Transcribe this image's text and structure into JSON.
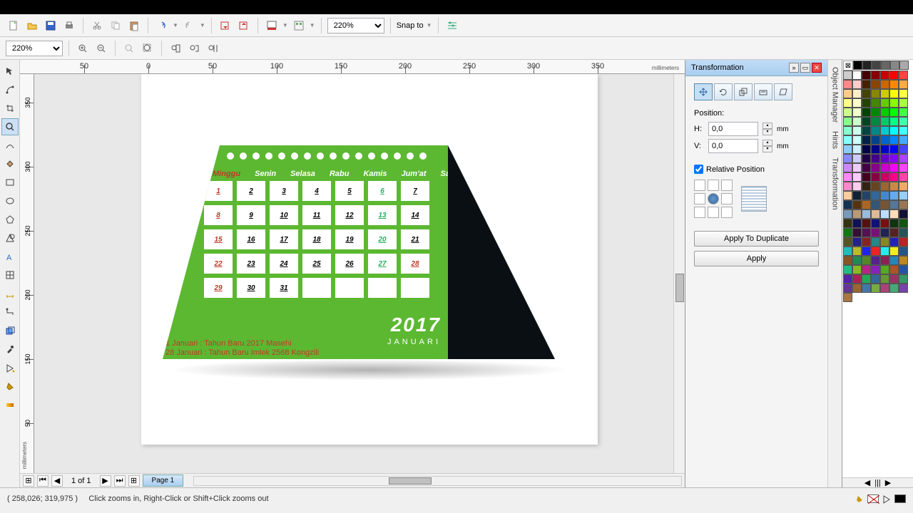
{
  "toolbar": {
    "zoom_main": "220%",
    "zoom_top": "220%",
    "snap_label": "Snap to"
  },
  "rulers": {
    "h_ticks": [
      {
        "v": "50",
        "p": 90
      },
      {
        "v": "0",
        "p": 180
      },
      {
        "v": "50",
        "p": 270
      },
      {
        "v": "100",
        "p": 360
      },
      {
        "v": "150",
        "p": 450
      },
      {
        "v": "200",
        "p": 540
      },
      {
        "v": "250",
        "p": 630
      },
      {
        "v": "300",
        "p": 720
      },
      {
        "v": "350",
        "p": 810
      }
    ],
    "v_ticks": [
      {
        "v": "350",
        "p": 40
      },
      {
        "v": "300",
        "p": 130
      },
      {
        "v": "250",
        "p": 220
      },
      {
        "v": "200",
        "p": 310
      },
      {
        "v": "150",
        "p": 400
      },
      {
        "v": "50",
        "p": 490
      }
    ],
    "unit": "millimeters"
  },
  "pagebar": {
    "counter": "1 of 1",
    "tab": "Page 1"
  },
  "panel": {
    "title": "Transformation",
    "section": "Position:",
    "h_label": "H:",
    "h_val": "0,0",
    "v_label": "V:",
    "v_val": "0,0",
    "unit": "mm",
    "relative": "Relative Position",
    "apply_dup": "Apply To Duplicate",
    "apply": "Apply"
  },
  "side_tabs": [
    "Object Manager",
    "Hints",
    "Transformation"
  ],
  "calendar": {
    "days": [
      "Minggu",
      "Senin",
      "Selasa",
      "Rabu",
      "Kamis",
      "Jum'at",
      "Sabtu"
    ],
    "cells": [
      {
        "n": "1",
        "c": "red"
      },
      {
        "n": "2"
      },
      {
        "n": "3"
      },
      {
        "n": "4"
      },
      {
        "n": "5"
      },
      {
        "n": "6",
        "c": "green"
      },
      {
        "n": "7"
      },
      {
        "n": "8",
        "c": "red"
      },
      {
        "n": "9"
      },
      {
        "n": "10"
      },
      {
        "n": "11"
      },
      {
        "n": "12"
      },
      {
        "n": "13",
        "c": "green"
      },
      {
        "n": "14"
      },
      {
        "n": "15",
        "c": "red"
      },
      {
        "n": "16"
      },
      {
        "n": "17"
      },
      {
        "n": "18"
      },
      {
        "n": "19"
      },
      {
        "n": "20",
        "c": "green"
      },
      {
        "n": "21"
      },
      {
        "n": "22",
        "c": "red"
      },
      {
        "n": "23"
      },
      {
        "n": "24"
      },
      {
        "n": "25"
      },
      {
        "n": "26"
      },
      {
        "n": "27",
        "c": "green"
      },
      {
        "n": "28",
        "c": "red"
      },
      {
        "n": "29",
        "c": "red"
      },
      {
        "n": "30"
      },
      {
        "n": "31"
      },
      {
        "n": ""
      },
      {
        "n": ""
      },
      {
        "n": ""
      },
      {
        "n": ""
      }
    ],
    "year": "2017",
    "month": "JANUARI",
    "footer1": "1 Januari  :  Tahun Baru 2017 Masehi",
    "footer2": "28 Januari :  Tahun Baru Imlek 2568 Kongzili"
  },
  "palette_colors": [
    "#000",
    "#222",
    "#444",
    "#666",
    "#888",
    "#aaa",
    "#ccc",
    "#fff",
    "#400",
    "#800",
    "#c00",
    "#f00",
    "#f44",
    "#f88",
    "#fcc",
    "#420",
    "#840",
    "#c60",
    "#f80",
    "#fa4",
    "#fc8",
    "#fec",
    "#440",
    "#880",
    "#cc0",
    "#ff0",
    "#ff4",
    "#ff8",
    "#ffc",
    "#240",
    "#480",
    "#6c0",
    "#8f0",
    "#af4",
    "#cf8",
    "#efc",
    "#040",
    "#080",
    "#0c0",
    "#0f0",
    "#4f4",
    "#8f8",
    "#cfc",
    "#042",
    "#084",
    "#0c6",
    "#0f8",
    "#4fa",
    "#8fc",
    "#cfe",
    "#044",
    "#088",
    "#0cc",
    "#0ff",
    "#4ff",
    "#8ff",
    "#cff",
    "#024",
    "#048",
    "#06c",
    "#08f",
    "#4af",
    "#8cf",
    "#cef",
    "#004",
    "#008",
    "#00c",
    "#00f",
    "#44f",
    "#88f",
    "#ccf",
    "#204",
    "#408",
    "#60c",
    "#80f",
    "#a4f",
    "#c8f",
    "#ecf",
    "#404",
    "#808",
    "#c0c",
    "#f0f",
    "#f4f",
    "#f8f",
    "#fcf",
    "#402",
    "#804",
    "#c06",
    "#f08",
    "#f4a",
    "#f8c",
    "#fce",
    "#321",
    "#642",
    "#963",
    "#c84",
    "#ea6",
    "#fc9",
    "#123",
    "#246",
    "#369",
    "#48c",
    "#6ae",
    "#9cf",
    "#135",
    "#531",
    "#a62",
    "#357",
    "#753",
    "#579",
    "#975",
    "#79b",
    "#b97",
    "#9bd",
    "#db9",
    "#bdf",
    "#fdb",
    "#113",
    "#331",
    "#115",
    "#511",
    "#117",
    "#711",
    "#131",
    "#151",
    "#171",
    "#313",
    "#515",
    "#717",
    "#225",
    "#522",
    "#255",
    "#552",
    "#228",
    "#822",
    "#288",
    "#882",
    "#22b",
    "#b22",
    "#2bb",
    "#bb2",
    "#22e",
    "#e22",
    "#2ee",
    "#ee2",
    "#258",
    "#852",
    "#285",
    "#582",
    "#528",
    "#825",
    "#28b",
    "#b82",
    "#2b8",
    "#8b2",
    "#b28",
    "#82b",
    "#5a2",
    "#a52",
    "#25a",
    "#52a",
    "#a25",
    "#2a5",
    "#369",
    "#693",
    "#936",
    "#396",
    "#639",
    "#963",
    "#47a",
    "#7a4",
    "#a47",
    "#4a7",
    "#74a",
    "#a74"
  ],
  "status": {
    "coords": "( 258,026; 319,975 )",
    "hint": "Click zooms in, Right-Click or Shift+Click zooms out"
  }
}
